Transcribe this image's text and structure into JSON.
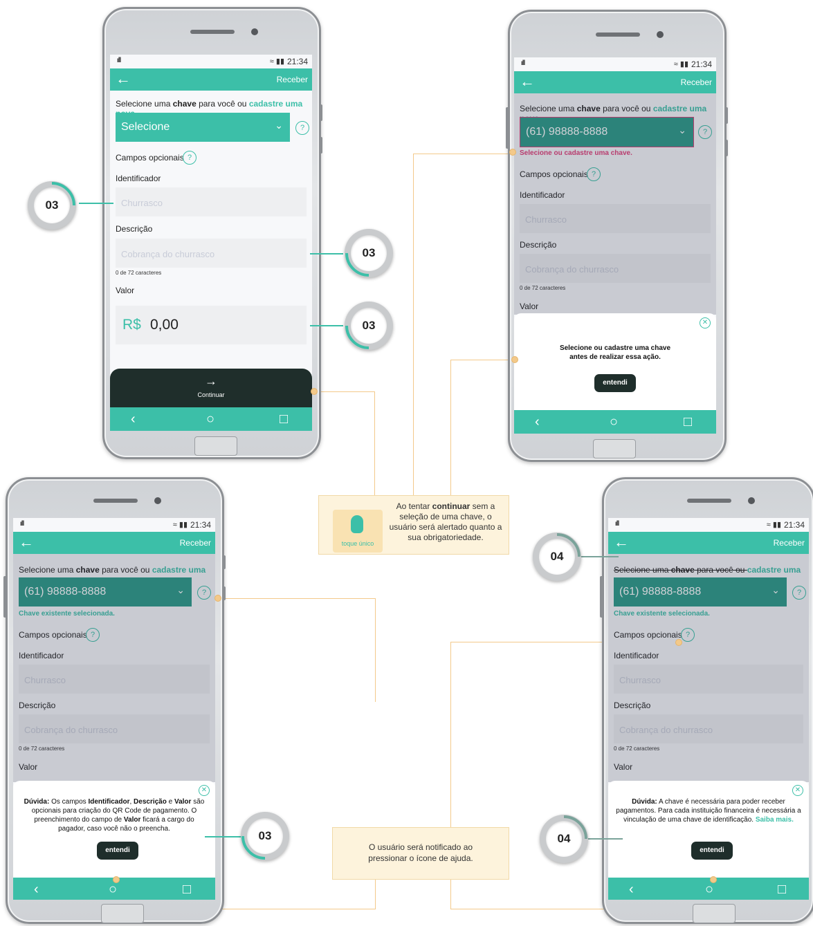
{
  "common": {
    "status_time": "21:34",
    "signal": "ıll",
    "status_icons": "≈ ▮▮",
    "back_arrow": "←",
    "header_action": "Receber",
    "select_prompt_pre": "Selecione uma ",
    "select_prompt_bold": "chave",
    "select_prompt_mid": " para você ou ",
    "select_prompt_link": "cadastre uma nova",
    "optional_fields": "Campos opcionais",
    "help_glyph": "?",
    "identifier_label": "Identificador",
    "identifier_placeholder": "Churrasco",
    "description_label": "Descrição",
    "description_placeholder": "Cobrança do churrasco",
    "char_count": "0 de 72 caracteres",
    "value_label": "Valor",
    "nav_back": "‹",
    "nav_home": "○",
    "nav_recent": "□",
    "chevron": "⌄",
    "close_glyph": "✕"
  },
  "screen1": {
    "select_value": "Selecione",
    "currency": "R$",
    "amount": "0,00",
    "continue_arrow": "→",
    "continue_label": "Continuar"
  },
  "screen2": {
    "select_value": "(61) 98888-8888",
    "error_text": "Selecione ou cadastre uma chave.",
    "modal_line1": "Selecione ou cadastre uma chave",
    "modal_line2": "antes de realizar essa ação.",
    "modal_button": "entendi"
  },
  "screen3": {
    "select_value": "(61) 98888-8888",
    "ok_text": "Chave existente selecionada.",
    "modal_lead": "Dúvida:",
    "modal_t1": " Os campos ",
    "modal_b1": "Identificador",
    "modal_t2": ", ",
    "modal_b2": "Descrição",
    "modal_t3": " e ",
    "modal_b3": "Valor",
    "modal_t4": " são opcionais para criação do QR Code de pagamento. O preenchimento do campo de ",
    "modal_b4": "Valor",
    "modal_t5": " ficará a cargo do pagador, caso você não o preencha.",
    "modal_button": "entendi"
  },
  "screen4": {
    "select_value": "(61) 98888-8888",
    "ok_text": "Chave existente selecionada.",
    "modal_lead": "Dúvida:",
    "modal_text": " A chave é necessária para poder receber pagamentos. Para cada instituição financeira é necessária a vinculação de uma chave de identificação.",
    "modal_link": "Saiba mais.",
    "modal_button": "entendi"
  },
  "badges": {
    "b1": "03",
    "b2": "03",
    "b3": "03",
    "b4": "04",
    "b5": "03",
    "b6": "04"
  },
  "notes": {
    "touch_caption": "toque único",
    "note1_pre": "Ao tentar ",
    "note1_bold": "continuar",
    "note1_post": " sem a seleção de uma chave, o usuário será alertado quanto a sua obrigatoriedade.",
    "note2": "O usuário será notificado ao pressionar o ícone de ajuda."
  },
  "colors": {
    "accent": "#3cbfa8",
    "dark_button": "#1f2e2b",
    "error": "#e0407a",
    "note_bg": "#fdf3dc",
    "connector": "#f3c98a"
  }
}
